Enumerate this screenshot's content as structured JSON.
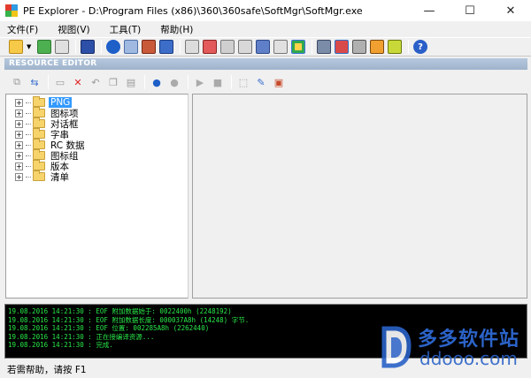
{
  "window": {
    "title": "PE Explorer - D:\\Program Files (x86)\\360\\360safe\\SoftMgr\\SoftMgr.exe",
    "minimize": "—",
    "maximize": "☐",
    "close": "✕"
  },
  "menu": {
    "items": [
      {
        "label": "文件(F)"
      },
      {
        "label": "视图(V)"
      },
      {
        "label": "工具(T)"
      },
      {
        "label": "帮助(H)"
      }
    ]
  },
  "toolbar_icons": [
    "open-icon",
    "refresh-icon",
    "export-icon",
    "save-icon",
    "info-icon",
    "headers-icon",
    "sections-icon",
    "resources-icon",
    "imports-icon",
    "exports-icon",
    "disassembler-icon",
    "dependency-icon",
    "relocations-icon",
    "debug-icon",
    "resource-editor-icon",
    "settings-icon",
    "plugins-icon",
    "tools-icon",
    "help-icon"
  ],
  "resource_editor": {
    "header": "RESOURCE EDITOR"
  },
  "tree": {
    "items": [
      {
        "label": "PNG",
        "selected": true
      },
      {
        "label": "图标项",
        "selected": false
      },
      {
        "label": "对话框",
        "selected": false
      },
      {
        "label": "字串",
        "selected": false
      },
      {
        "label": "RC 数据",
        "selected": false
      },
      {
        "label": "图标组",
        "selected": false
      },
      {
        "label": "版本",
        "selected": false
      },
      {
        "label": "清单",
        "selected": false
      }
    ],
    "expander_symbol": "+"
  },
  "log": {
    "lines": [
      "19.08.2016 14:21:30 : EOF 附加数据始于: 0022400h  (2248192)",
      "19.08.2016 14:21:30 : EOF 附加数据长度: 000037A8h  (14248) 字节.",
      "19.08.2016 14:21:30 : EOF 位置: 002285A8h  (2262440)",
      "19.08.2016 14:21:30 : 正在接编译资源...",
      "19.08.2016 14:21:30 : 完成."
    ]
  },
  "status": {
    "text": "若需帮助，请按 F1"
  },
  "watermark": {
    "title": "多多软件站",
    "url": "ddooo.com"
  }
}
